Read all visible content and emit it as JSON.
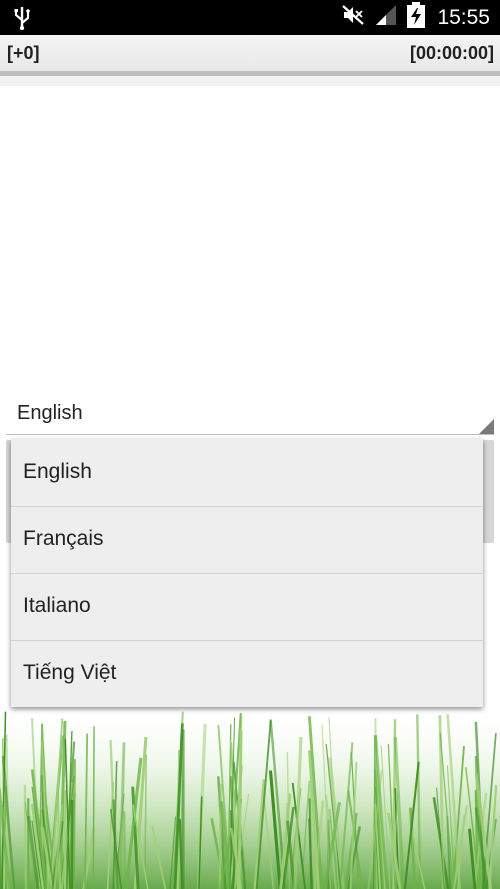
{
  "status_bar": {
    "time": "15:55",
    "icons": [
      "usb-icon",
      "mute-icon",
      "signal-icon",
      "battery-charging-icon"
    ]
  },
  "info_bar": {
    "score": "[+0]",
    "timer": "[00:00:00]"
  },
  "language_spinner": {
    "selected": "English"
  },
  "language_options": [
    "English",
    "Français",
    "Italiano",
    "Tiếng Việt"
  ],
  "colors": {
    "dropdown_bg": "#eeeeee",
    "status_bar_bg": "#000000",
    "grass": "#5aa43a"
  }
}
